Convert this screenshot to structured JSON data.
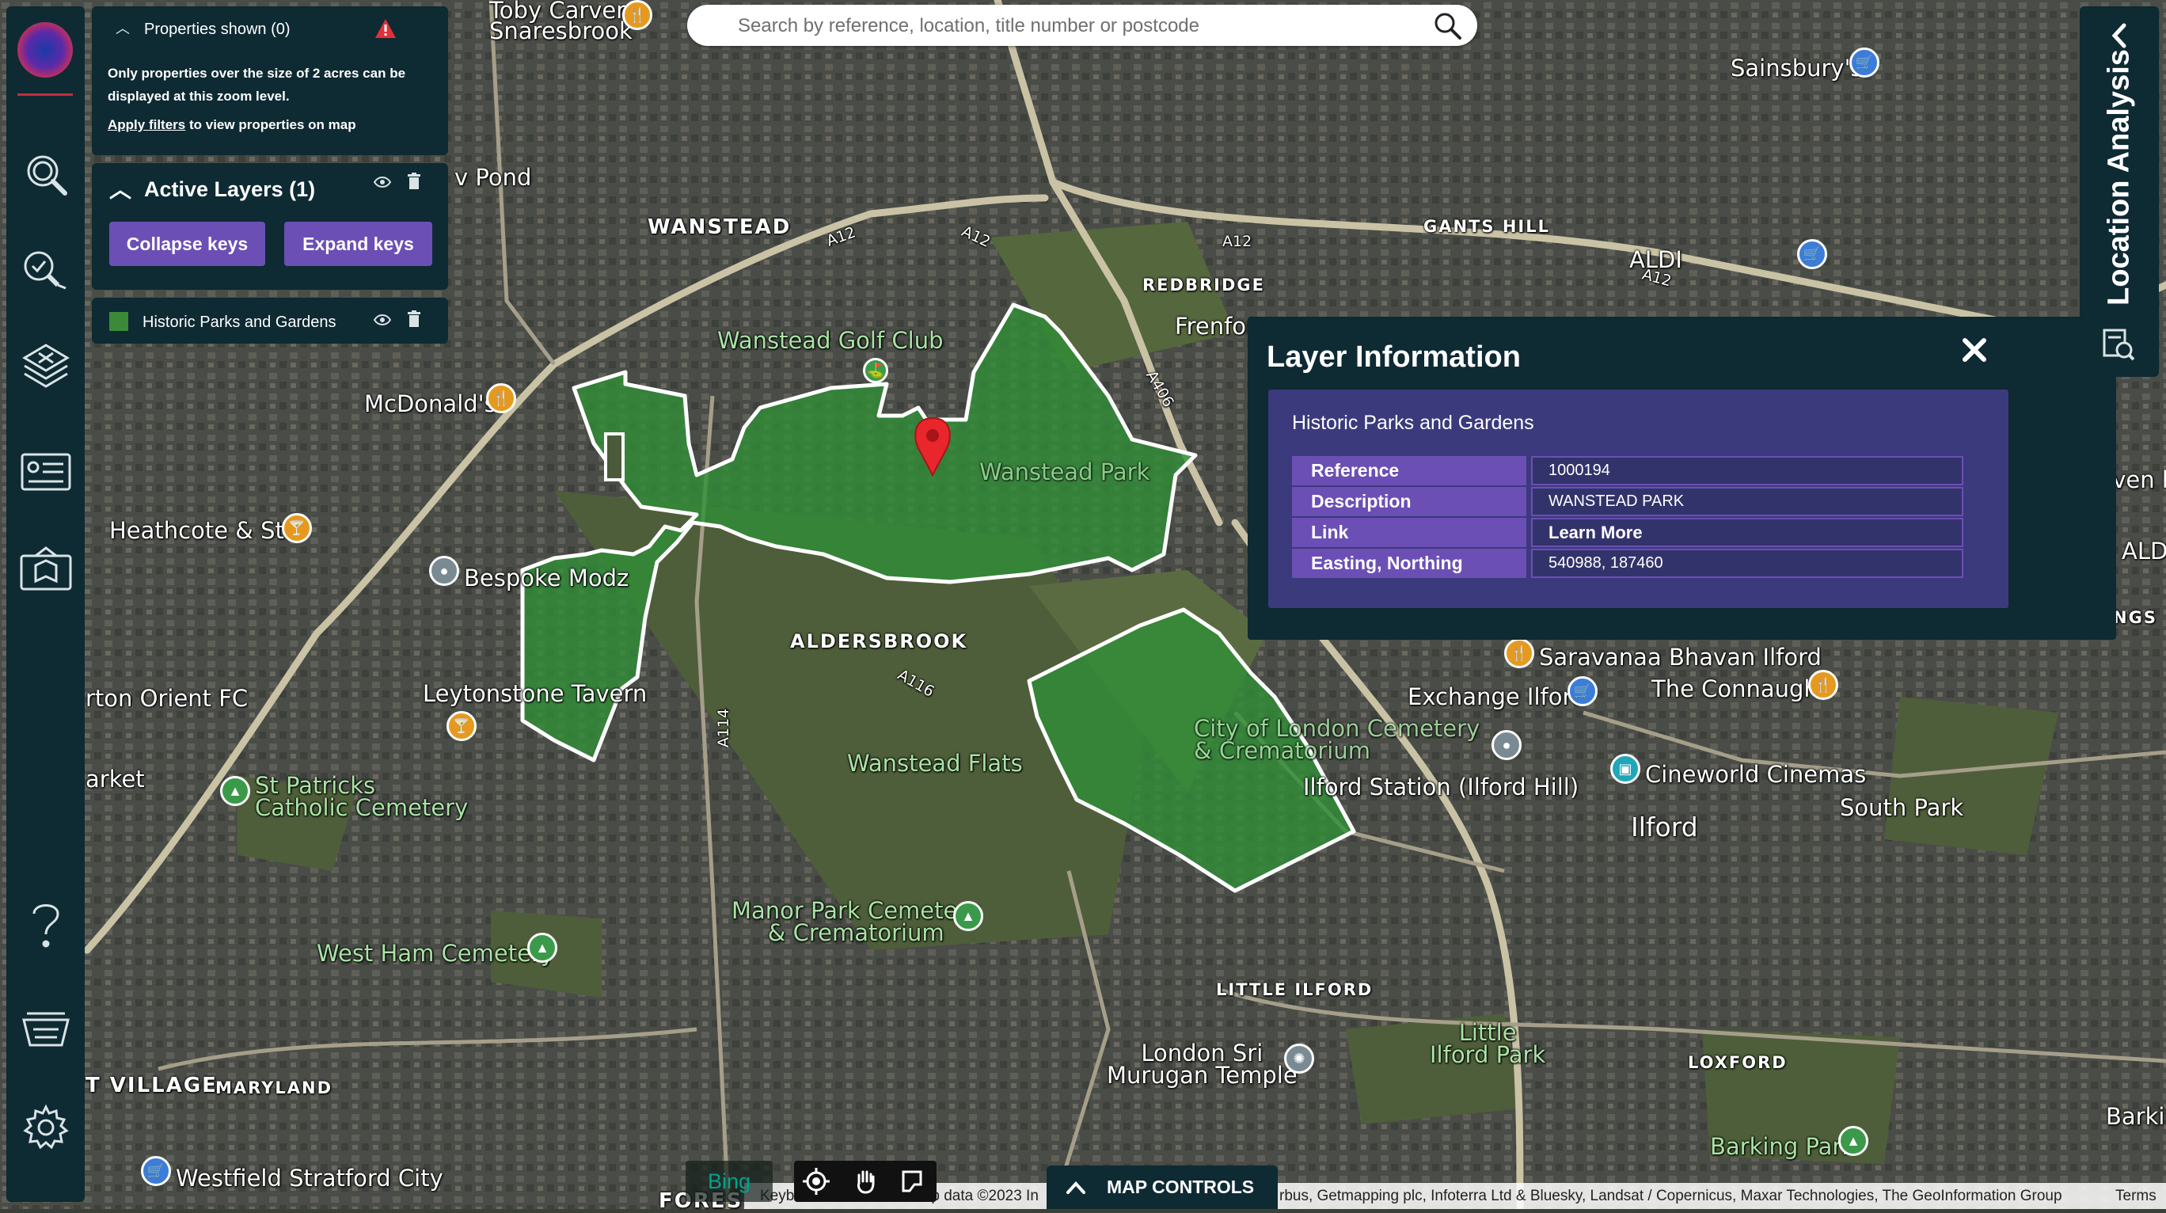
{
  "search": {
    "placeholder": "Search by reference, location, title number or postcode"
  },
  "properties_panel": {
    "title": "Properties shown (0)",
    "message": "Only properties over the size of 2 acres can be displayed at this zoom level.",
    "link": "Apply filters",
    "link_suffix": " to view properties on map"
  },
  "layers_panel": {
    "title": "Active Layers (1)",
    "collapse_label": "Collapse keys",
    "expand_label": "Expand keys",
    "layers": [
      {
        "name": "Historic Parks and Gardens",
        "color": "#3a8a3a"
      }
    ]
  },
  "layer_info": {
    "title": "Layer Information",
    "subtitle": "Historic Parks and Gardens",
    "rows": [
      {
        "key": "Reference",
        "value": "1000194"
      },
      {
        "key": "Description",
        "value": "WANSTEAD PARK"
      },
      {
        "key": "Link",
        "value": "Learn More"
      },
      {
        "key": "Easting, Northing",
        "value": "540988, 187460"
      }
    ]
  },
  "right_tab": {
    "title": "Location Analysis"
  },
  "map_controls": {
    "label": "MAP CONTROLS"
  },
  "bing": {
    "label": "Bing"
  },
  "attribution": {
    "left": "Keyboard shortcuts",
    "mid": "Map data ©2023 In",
    "right": "rbus, Getmapping plc, Infoterra Ltd & Bluesky, Landsat / Copernicus, Maxar Technologies, The GeoInformation Group",
    "terms": "Terms"
  },
  "map_labels": {
    "toby": "Toby Carvery\nSnaresbrook",
    "pond": "v Pond",
    "wanstead": "WANSTEAD",
    "golf": "Wanstead Golf Club",
    "mcdonalds": "McDonald's",
    "wanstead_park": "Wanstead Park",
    "heathcote": "Heathcote & Star",
    "bespoke": "Bespoke Modz",
    "aldersbrook": "ALDERSBROOK",
    "leytonstone": "Leytonstone Tavern",
    "orient": "rton Orient FC",
    "wanstead_flats": "Wanstead Flats",
    "market": "arket",
    "st_patricks": "St Patricks\nCatholic Cemetery",
    "manor_park": "Manor Park Cemetery\n& Crematorium",
    "west_ham": "West Ham Cemetery",
    "t_village": "T VILLAGE",
    "maryland": "MARYLAND",
    "westfield": "Westfield Stratford City",
    "forest": "FORES",
    "redbridge": "REDBRIDGE",
    "gants_hill": "GANTS HILL",
    "sainsburys": "Sainsbury's",
    "aldi": "ALDI",
    "seven_kings_left": "Seven ki",
    "seven_kings": "SEVEN KINGS",
    "ald_right": "ALD",
    "saravanaa": "Saravanaa Bhavan Ilford",
    "exchange": "Exchange Ilford",
    "connaught": "The Connaught",
    "col": "City of London Cemetery\n& Crematorium",
    "ilford_station": "Ilford Station (Ilford Hill)",
    "cineworld": "Cineworld Cinemas",
    "south_park": "South Park",
    "ilford": "Ilford",
    "little_ilford": "LITTLE ILFORD",
    "london_sri": "London Sri\nMurugan Temple",
    "little_ilford_park": "Little\nIlford Park",
    "loxford": "LOXFORD",
    "barking_park": "Barking Park",
    "barkin": "Barkin",
    "frenford": "Frenfor",
    "a12": "A12",
    "a406": "A406",
    "a114": "A114",
    "a116": "A116"
  }
}
